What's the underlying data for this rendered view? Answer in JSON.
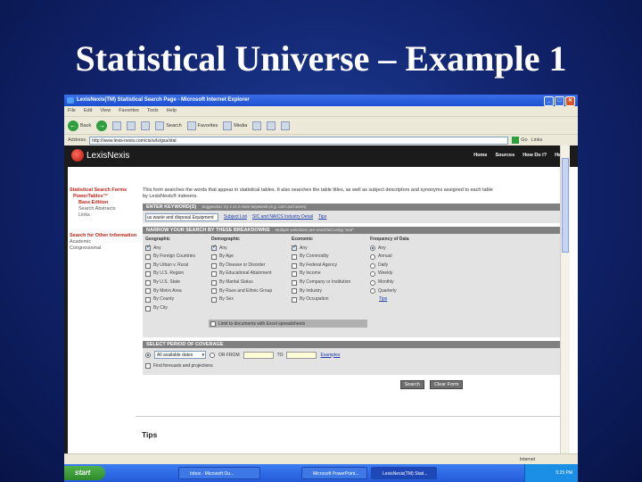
{
  "slide": {
    "title": "Statistical Universe – Example 1"
  },
  "browser": {
    "window_title": "LexisNexis(TM) Statistical Search Page - Microsoft Internet Explorer",
    "menu": [
      "File",
      "Edit",
      "View",
      "Favorites",
      "Tools",
      "Help"
    ],
    "toolbar": {
      "back": "Back",
      "search": "Search",
      "favorites": "Favorites",
      "media": "Media"
    },
    "address_label": "Address",
    "address": "http://www.lexis-nexis.com/cis/urls/gsa/stat",
    "go": "Go",
    "links": "Links"
  },
  "site": {
    "logo": "LexisNexis",
    "topnav": [
      "Home",
      "Sources",
      "How Do I?",
      "Help"
    ],
    "leftnav": {
      "title": "Statistical Search Forms",
      "product": "PowerTables™",
      "edition": "Base Edition",
      "items": [
        "Search Abstracts",
        "Links"
      ],
      "other_title": "Search for Other Information",
      "other_items": [
        "Academic",
        "Congressional"
      ]
    },
    "intro": "This form searches the words that appear in statistical tables. It also searches the table titles, as well as subject descriptors and synonyms assigned to each table by LexisNexis® indexers.",
    "keyword": {
      "header": "ENTER KEYWORD(S)",
      "hint": "Suggestion: try 1 or 2 more keywords (e.g. corn and acres)",
      "value": "us waste and disposal Equipment",
      "links": [
        "Subject List",
        "SIC and NAICS Industry Detail",
        "Tips"
      ]
    },
    "breakdowns": {
      "header": "NARROW YOUR SEARCH BY THESE BREAKDOWNS",
      "hint": "Multiple selections are searched using \"and\"",
      "geographic": {
        "title": "Geographic",
        "options": [
          "Any",
          "By Foreign Countries",
          "By Urban v. Rural",
          "By U.S. Region",
          "By U.S. State",
          "By Metro Area",
          "By County",
          "By City"
        ]
      },
      "demographic": {
        "title": "Demographic",
        "options": [
          "Any",
          "By Age",
          "By Disease or Disorder",
          "By Educational Attainment",
          "By Marital Status",
          "By Race and Ethnic Group",
          "By Sex"
        ]
      },
      "economic": {
        "title": "Economic",
        "options": [
          "Any",
          "By Commodity",
          "By Federal Agency",
          "By Income",
          "By Company or Institution",
          "By Industry",
          "By Occupation"
        ]
      },
      "frequency": {
        "title": "Frequency of Data",
        "options": [
          "Any",
          "Annual",
          "Daily",
          "Weekly",
          "Monthly",
          "Quarterly"
        ],
        "tips": "Tips"
      },
      "limit_text": "Limit to documents with Excel spreadsheets"
    },
    "period": {
      "header": "SELECT PERIOD OF COVERAGE",
      "select_value": "All available dates",
      "or_from": "OR FROM",
      "to": "TO",
      "examples": "Examples",
      "include_text": "Find forecasts and projections"
    },
    "buttons": {
      "search": "Search",
      "clear": "Clear Form"
    },
    "tips_heading": "Tips"
  },
  "statusbar": {
    "zone": "Internet"
  },
  "taskbar": {
    "start": "start",
    "tasks": [
      "Inbox - Microsoft Ou...",
      "Microsoft PowerPoint...",
      "LexisNexis(TM) Stati..."
    ],
    "clock": "5:25 PM"
  }
}
